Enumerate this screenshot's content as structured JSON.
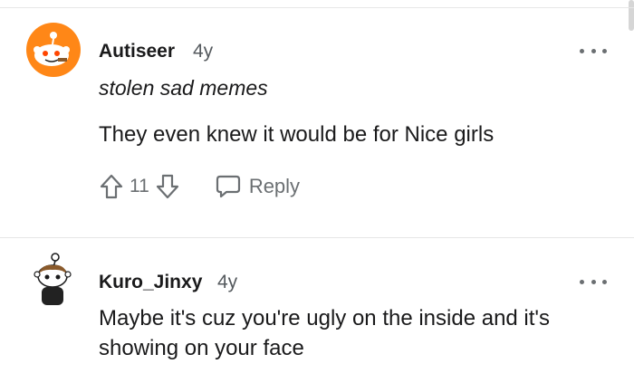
{
  "comments": [
    {
      "username": "Autiseer",
      "age": "4y",
      "flair": "stolen sad memes",
      "body": "They even knew it would be for Nice girls",
      "score": "11",
      "reply_label": "Reply",
      "avatar_icon": "snoo-avatar-orange-icon",
      "more_icon": "more-options-icon"
    },
    {
      "username": "Kuro_Jinxy",
      "age": "4y",
      "body": "Maybe it's cuz you're ugly on the inside and it's showing on your face",
      "avatar_icon": "snoo-avatar-custom-icon",
      "more_icon": "more-options-icon"
    }
  ],
  "colors": {
    "accent_orange": "#ff8717",
    "text": "#1a1a1b",
    "muted": "#6b6f72",
    "separator": "#e6e6e6"
  }
}
